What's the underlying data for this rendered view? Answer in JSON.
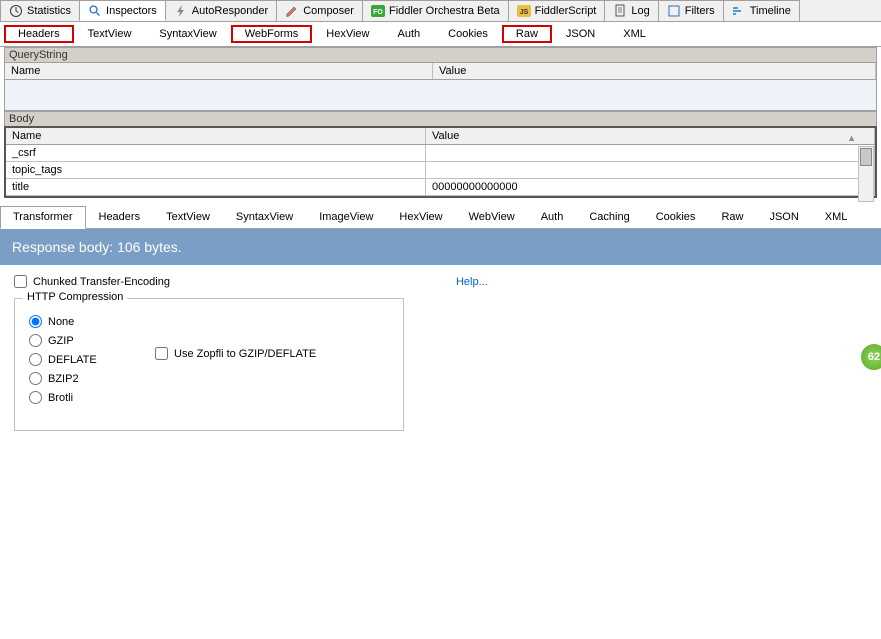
{
  "mainTabs": {
    "statistics": "Statistics",
    "inspectors": "Inspectors",
    "autoresponder": "AutoResponder",
    "composer": "Composer",
    "orchestra": "Fiddler Orchestra Beta",
    "fiddlerscript": "FiddlerScript",
    "log": "Log",
    "filters": "Filters",
    "timeline": "Timeline"
  },
  "subTabs": {
    "headers": "Headers",
    "textview": "TextView",
    "syntaxview": "SyntaxView",
    "webforms": "WebForms",
    "hexview": "HexView",
    "auth": "Auth",
    "cookies": "Cookies",
    "raw": "Raw",
    "json": "JSON",
    "xml": "XML"
  },
  "sections": {
    "querystring": "QueryString",
    "body": "Body"
  },
  "columns": {
    "name": "Name",
    "value": "Value"
  },
  "bodyRows": [
    {
      "name": "_csrf",
      "value": ""
    },
    {
      "name": "topic_tags",
      "value": ""
    },
    {
      "name": "title",
      "value": "00000000000000"
    }
  ],
  "responseTabs": {
    "transformer": "Transformer",
    "headers": "Headers",
    "textview": "TextView",
    "syntaxview": "SyntaxView",
    "imageview": "ImageView",
    "hexview": "HexView",
    "webview": "WebView",
    "auth": "Auth",
    "caching": "Caching",
    "cookies": "Cookies",
    "raw": "Raw",
    "json": "JSON",
    "xml": "XML"
  },
  "responseBanner": "Response body: 106 bytes.",
  "transformer": {
    "chunked": "Chunked Transfer-Encoding",
    "help": "Help...",
    "compressionLabel": "HTTP Compression",
    "none": "None",
    "gzip": "GZIP",
    "deflate": "DEFLATE",
    "bzip2": "BZIP2",
    "brotli": "Brotli",
    "zopfli": "Use Zopfli to GZIP/DEFLATE"
  },
  "badge": "62"
}
